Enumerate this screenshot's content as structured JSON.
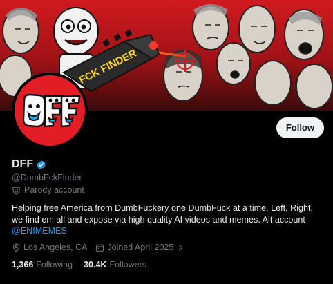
{
  "banner": {
    "finder_text": "FCK FINDER"
  },
  "avatar": {
    "logo_text": "DFF"
  },
  "actions": {
    "follow_label": "Follow"
  },
  "profile": {
    "display_name": "DFF",
    "handle": "@DumbFckFinder",
    "badge": "Parody account",
    "bio_text": "Helping free America from DumbFuckery one DumbFuck at a time, Left, Right, we find em all and expose via high quality AI videos and memes. Alt account",
    "bio_link": "@ENIMEMES",
    "location": "Los Angeles, CA",
    "joined": "Joined April 2025"
  },
  "stats": {
    "following_count": "1,366",
    "following_label": "Following",
    "followers_count": "30.4K",
    "followers_label": "Followers"
  },
  "colors": {
    "accent": "#1d9bf0",
    "avatar_bg": "#e21d25",
    "banner_red": "#c2161c"
  },
  "icons": [
    "verified-badge-icon",
    "parody-mask-icon",
    "location-pin-icon",
    "calendar-icon",
    "chevron-right-icon"
  ]
}
